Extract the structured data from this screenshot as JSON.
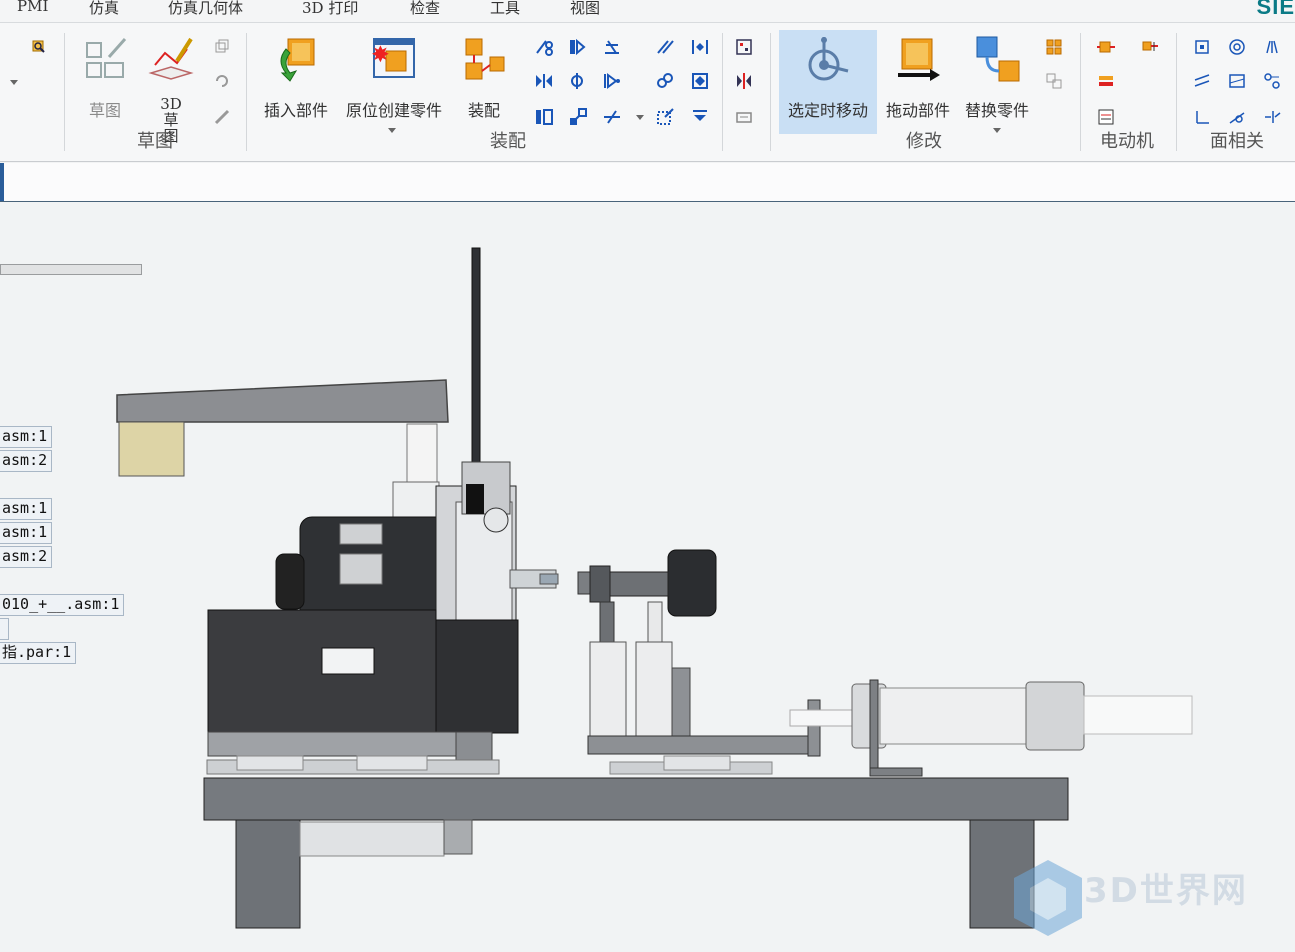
{
  "menu": {
    "items": [
      "PMI",
      "仿真",
      "仿真几何体",
      "3D 打印",
      "检查",
      "工具",
      "视图"
    ],
    "brand": "SIE"
  },
  "ribbon": {
    "groups": {
      "sketch": {
        "label": "草图",
        "buttons": [
          {
            "label": "草图",
            "icon": "sketch-grid-icon",
            "enabled": false
          },
          {
            "label": "3D 草图",
            "icon": "3d-sketch-icon",
            "enabled": true
          }
        ]
      },
      "assembly": {
        "label": "装配",
        "buttons": [
          {
            "label": "插入部件",
            "icon": "insert-component-icon"
          },
          {
            "label": "原位创建零件",
            "icon": "create-in-place-icon"
          },
          {
            "label": "装配",
            "icon": "assemble-icon"
          }
        ]
      },
      "modify": {
        "label": "修改",
        "buttons": [
          {
            "label": "选定时移动",
            "icon": "move-on-select-icon",
            "active": true
          },
          {
            "label": "拖动部件",
            "icon": "drag-component-icon"
          },
          {
            "label": "替换零件",
            "icon": "replace-part-icon"
          }
        ]
      },
      "motor": {
        "label": "电动机"
      },
      "face_relate": {
        "label": "面相关"
      }
    }
  },
  "tree": {
    "items": [
      "asm:1",
      "asm:2",
      "asm:1",
      "asm:1",
      "asm:2",
      "010_+__.asm:1",
      "",
      "指.par:1"
    ]
  },
  "watermark": {
    "text": "3D世界网"
  },
  "colors": {
    "accent": "#2a5d9a",
    "active_button": "#c9dff4",
    "brand": "#0a7a86"
  }
}
